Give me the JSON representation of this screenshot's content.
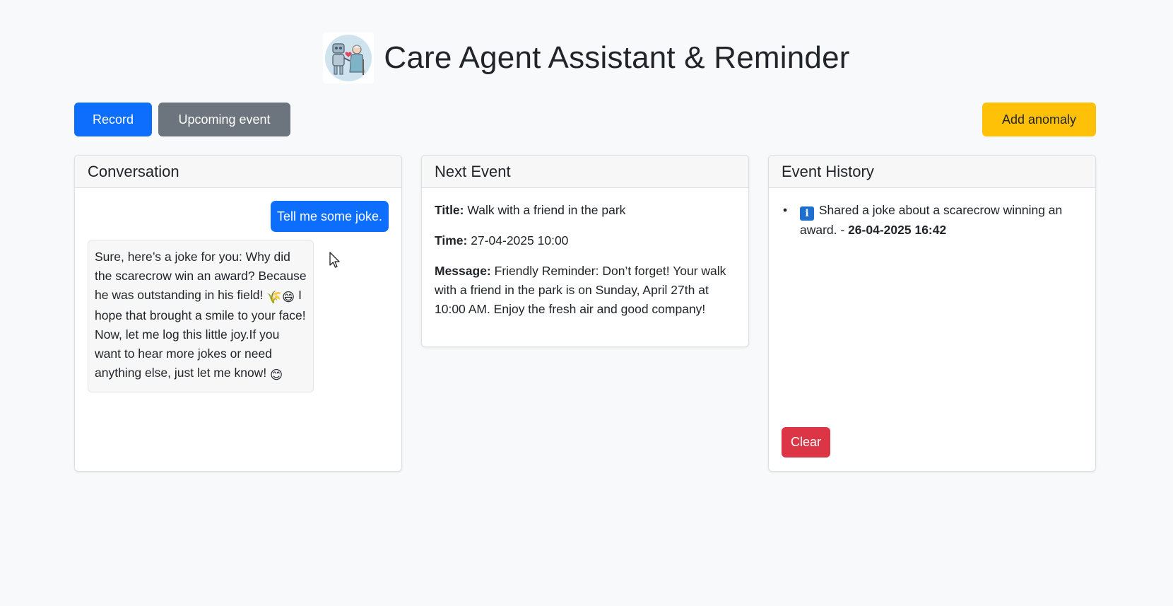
{
  "header": {
    "title": "Care Agent Assistant & Reminder",
    "logo_icon": "robot-and-elder-icon"
  },
  "toolbar": {
    "record_label": "Record",
    "upcoming_label": "Upcoming event",
    "anomaly_label": "Add anomaly"
  },
  "conversation": {
    "title": "Conversation",
    "user_message": "Tell me some joke.",
    "bot_message_part1": "Sure, here’s a joke for you: Why did the scarecrow win an award? Because he was outstanding in his field! ",
    "bot_message_part2": " I hope that brought a smile to your face! Now, let me log this little joy.If you want to hear more jokes or need anything else, just let me know! ",
    "emoji_1": "🌾",
    "emoji_2": "😄",
    "emoji_3": "😊"
  },
  "next_event": {
    "title": "Next Event",
    "title_label": "Title:",
    "title_value": "Walk with a friend in the park",
    "time_label": "Time:",
    "time_value": "27-04-2025 10:00",
    "message_label": "Message:",
    "message_value": "Friendly Reminder: Don’t forget! Your walk with a friend in the park is on Sunday, April 27th at 10:00 AM. Enjoy the fresh air and good company!"
  },
  "history": {
    "title": "Event History",
    "items": [
      {
        "icon": "info-icon",
        "icon_glyph": "i",
        "text": "Shared a joke about a scarecrow winning an award. - ",
        "timestamp": "26-04-2025 16:42"
      }
    ],
    "clear_label": "Clear"
  },
  "colors": {
    "primary": "#0d6efd",
    "secondary": "#6c757d",
    "warning": "#ffc107",
    "danger": "#dc3545",
    "background": "#f8f9fa"
  }
}
